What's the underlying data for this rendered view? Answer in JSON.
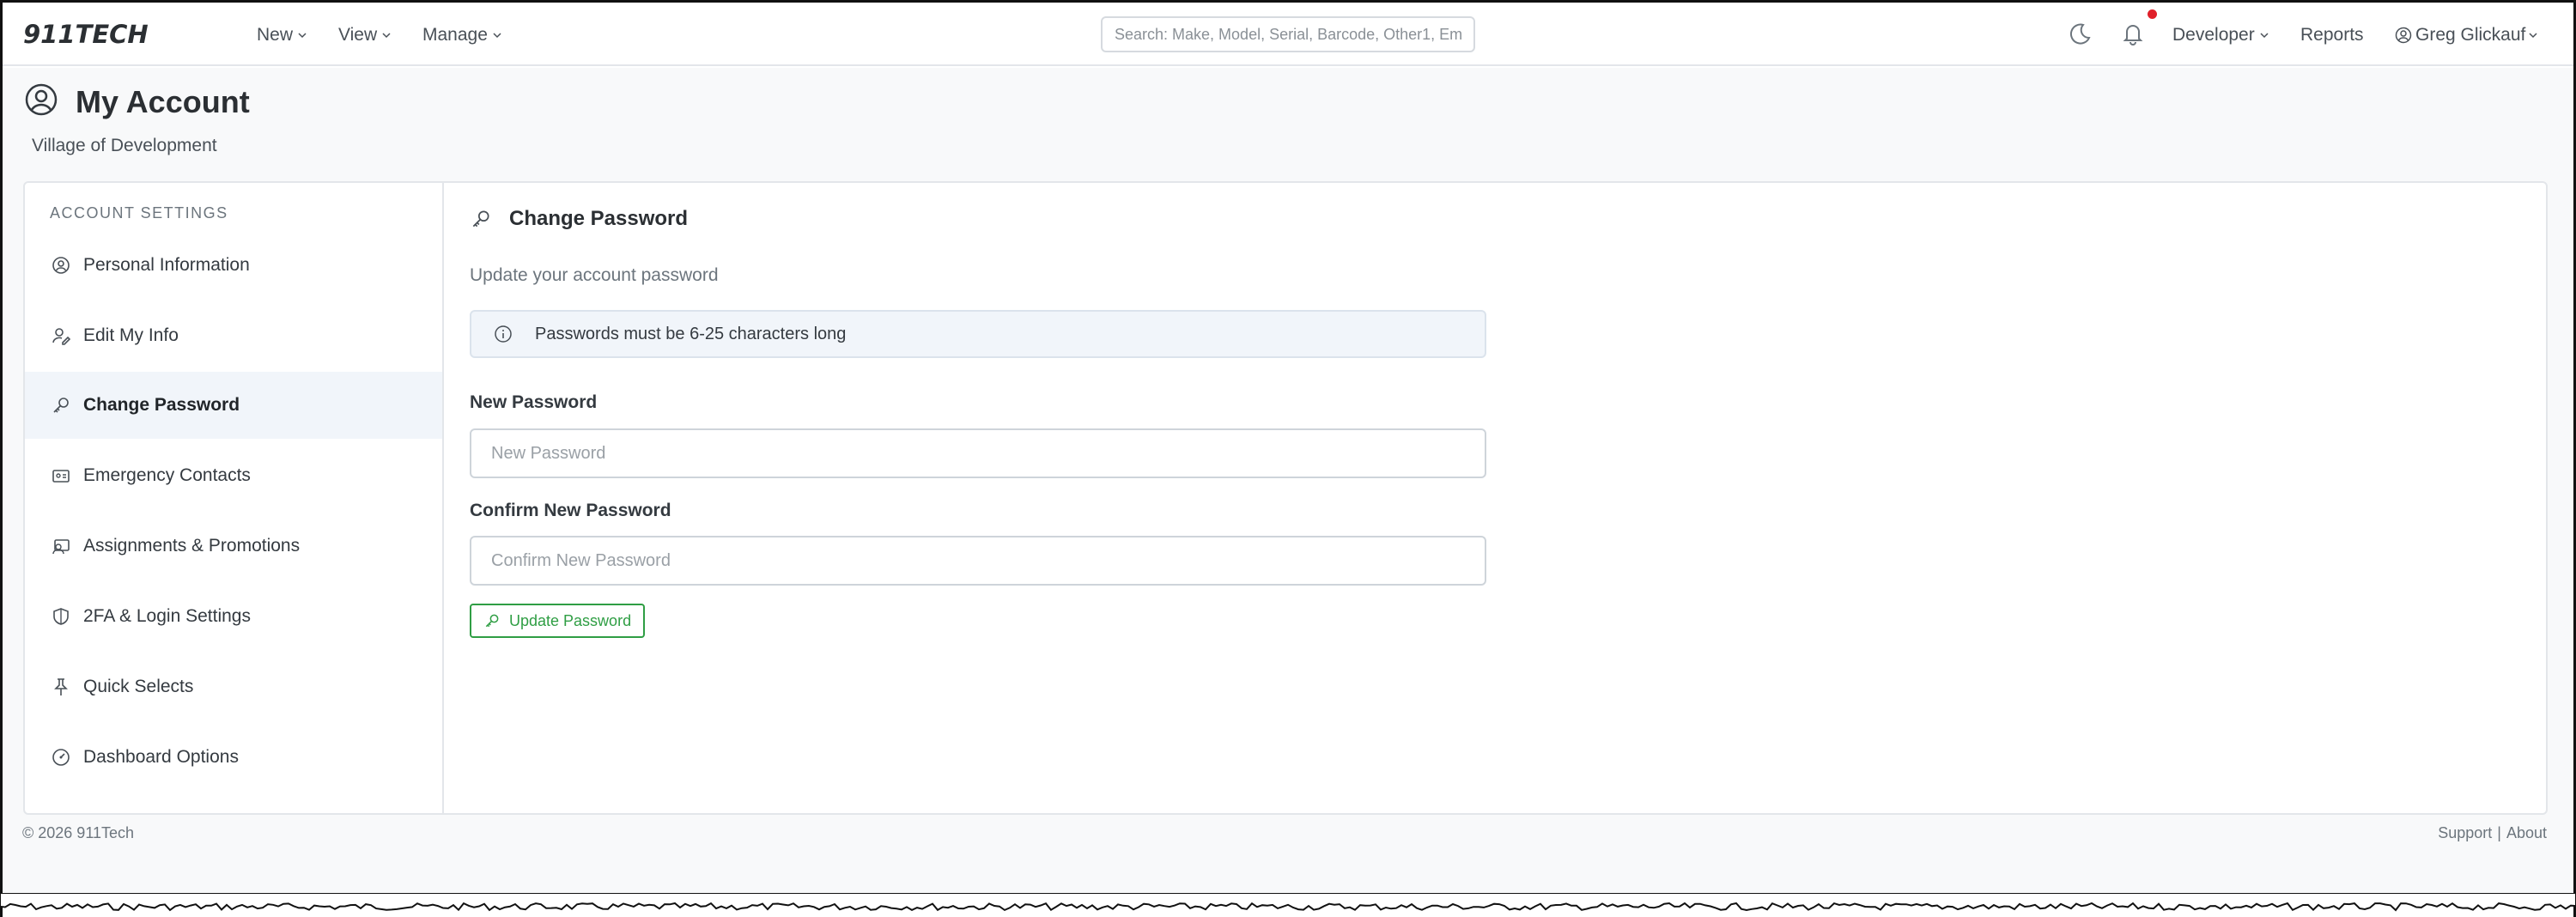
{
  "navbar": {
    "logo": "911TECH",
    "menu": [
      {
        "label": "New"
      },
      {
        "label": "View"
      },
      {
        "label": "Manage"
      }
    ],
    "search_placeholder": "Search: Make, Model, Serial, Barcode, Other1, Em",
    "developer_label": "Developer",
    "reports_label": "Reports",
    "user_label": "Greg Glickauf",
    "notification_dot_color": "#e0202a"
  },
  "page": {
    "title": "My Account",
    "subtitle": "Village of Development"
  },
  "sidebar": {
    "heading": "ACCOUNT SETTINGS",
    "items": [
      {
        "label": "Personal Information",
        "icon": "user-circle-icon"
      },
      {
        "label": "Edit My Info",
        "icon": "user-edit-icon"
      },
      {
        "label": "Change Password",
        "icon": "key-icon",
        "active": true
      },
      {
        "label": "Emergency Contacts",
        "icon": "id-card-icon"
      },
      {
        "label": "Assignments & Promotions",
        "icon": "badge-icon"
      },
      {
        "label": "2FA & Login Settings",
        "icon": "shield-icon"
      },
      {
        "label": "Quick Selects",
        "icon": "pin-icon"
      },
      {
        "label": "Dashboard Options",
        "icon": "dashboard-icon"
      }
    ]
  },
  "content": {
    "title": "Change Password",
    "subtitle": "Update your account password",
    "alert": "Passwords must be 6-25 characters long",
    "new_password_label": "New Password",
    "new_password_placeholder": "New Password",
    "confirm_password_label": "Confirm New Password",
    "confirm_password_placeholder": "Confirm New Password",
    "button_label": "Update Password",
    "button_color": "#2f9e44"
  },
  "footer": {
    "copyright": "© 2026 911Tech",
    "support": "Support",
    "separator": "|",
    "about": "About"
  }
}
